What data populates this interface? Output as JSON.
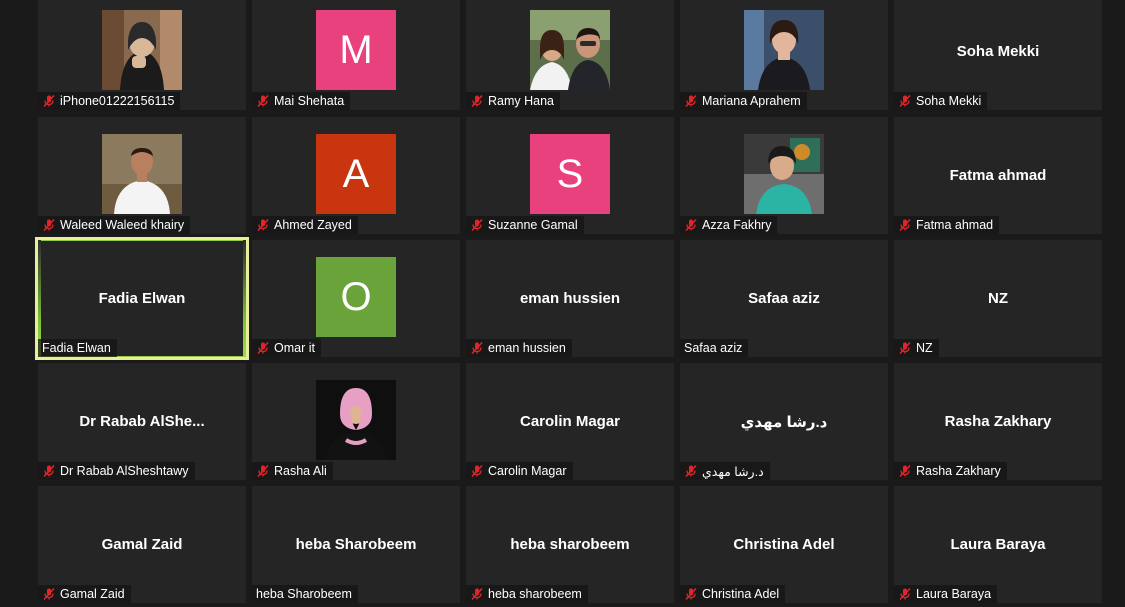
{
  "participants": [
    {
      "name": "iPhone01222156115",
      "muted": true,
      "tile": "photo",
      "photo": "woman-hijab-hand"
    },
    {
      "name": "Mai Shehata",
      "muted": true,
      "tile": "avatar",
      "initial": "M",
      "color": "#e8417e"
    },
    {
      "name": "Ramy Hana",
      "muted": true,
      "tile": "photo",
      "photo": "couple"
    },
    {
      "name": "Mariana Aprahem",
      "muted": true,
      "tile": "photo",
      "photo": "woman-dark"
    },
    {
      "name": "Soha Mekki",
      "muted": true,
      "tile": "name"
    },
    {
      "name": "Waleed Waleed khairy",
      "muted": true,
      "tile": "photo",
      "photo": "man-white-shirt"
    },
    {
      "name": "Ahmed Zayed",
      "muted": true,
      "tile": "avatar",
      "initial": "A",
      "color": "#c9350e"
    },
    {
      "name": "Suzanne Gamal",
      "muted": true,
      "tile": "avatar",
      "initial": "S",
      "color": "#e8417e"
    },
    {
      "name": "Azza Fakhry",
      "muted": true,
      "tile": "photo",
      "photo": "woman-teal-scarf"
    },
    {
      "name": "Fatma ahmad",
      "muted": true,
      "tile": "name"
    },
    {
      "name": "Fadia Elwan",
      "muted": false,
      "tile": "name",
      "speaking": true
    },
    {
      "name": "Omar it",
      "muted": true,
      "tile": "avatar",
      "initial": "O",
      "color": "#6aa33a"
    },
    {
      "name": "eman hussien",
      "muted": true,
      "tile": "name"
    },
    {
      "name": "Safaa aziz",
      "muted": false,
      "tile": "name"
    },
    {
      "name": "NZ",
      "muted": true,
      "tile": "name"
    },
    {
      "name": "Dr Rabab AlSheshtawy",
      "display": "Dr Rabab  AlShe...",
      "muted": true,
      "tile": "name"
    },
    {
      "name": "Rasha Ali",
      "muted": true,
      "tile": "photo",
      "photo": "woman-pink-hijab"
    },
    {
      "name": "Carolin Magar",
      "muted": true,
      "tile": "name"
    },
    {
      "name": "د.رشا مهدي",
      "muted": true,
      "tile": "name",
      "rtl": true
    },
    {
      "name": "Rasha Zakhary",
      "muted": true,
      "tile": "name"
    },
    {
      "name": "Gamal Zaid",
      "muted": true,
      "tile": "name"
    },
    {
      "name": "heba Sharobeem",
      "muted": false,
      "tile": "name"
    },
    {
      "name": "heba sharobeem",
      "muted": true,
      "tile": "name"
    },
    {
      "name": "Christina Adel",
      "muted": true,
      "tile": "name"
    },
    {
      "name": "Laura Baraya",
      "muted": true,
      "tile": "name"
    }
  ],
  "colors": {
    "tile_bg": "#252525",
    "page_bg": "#1a1a1a",
    "speaking_border": "#e8ee9a",
    "mute_icon": "#e0262a"
  }
}
